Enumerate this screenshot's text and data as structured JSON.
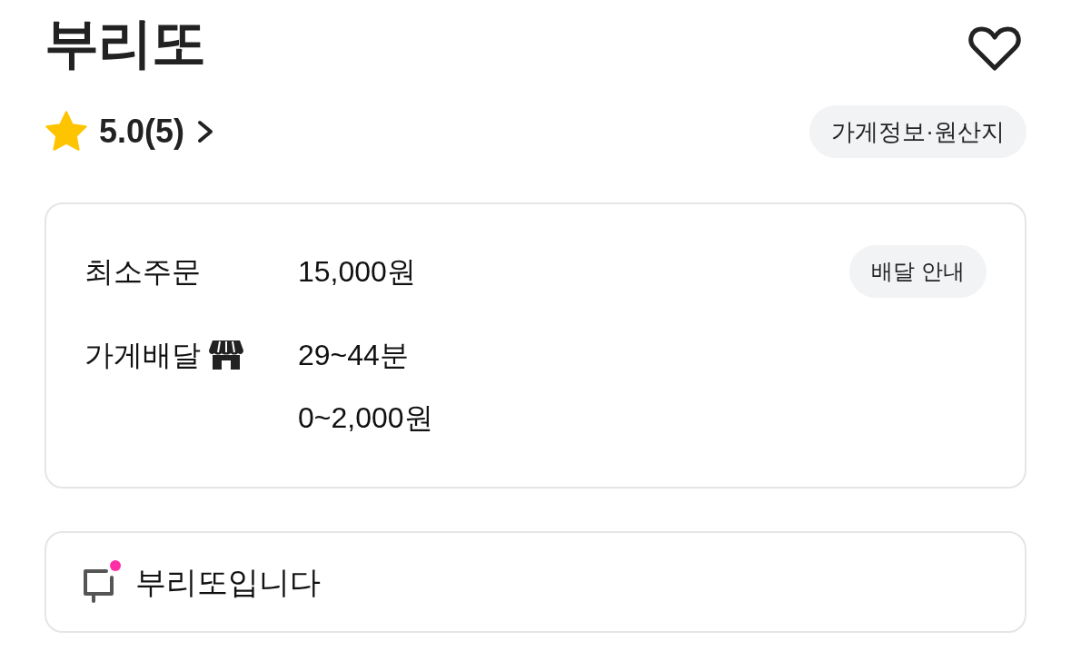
{
  "store": {
    "name": "부리또",
    "favorited": false
  },
  "rating": {
    "score": "5.0(5)"
  },
  "info_button": {
    "label": "가게정보·원산지"
  },
  "delivery_card": {
    "rows": [
      {
        "kind": "plain",
        "label": "최소주문",
        "values": [
          "15,000원"
        ],
        "button": "배달 안내"
      },
      {
        "kind": "marked",
        "label": "가게배달",
        "values": [
          "29~44분",
          "0~2,000원"
        ]
      }
    ]
  },
  "notice": {
    "text": "부리또입니다",
    "unread": true
  }
}
